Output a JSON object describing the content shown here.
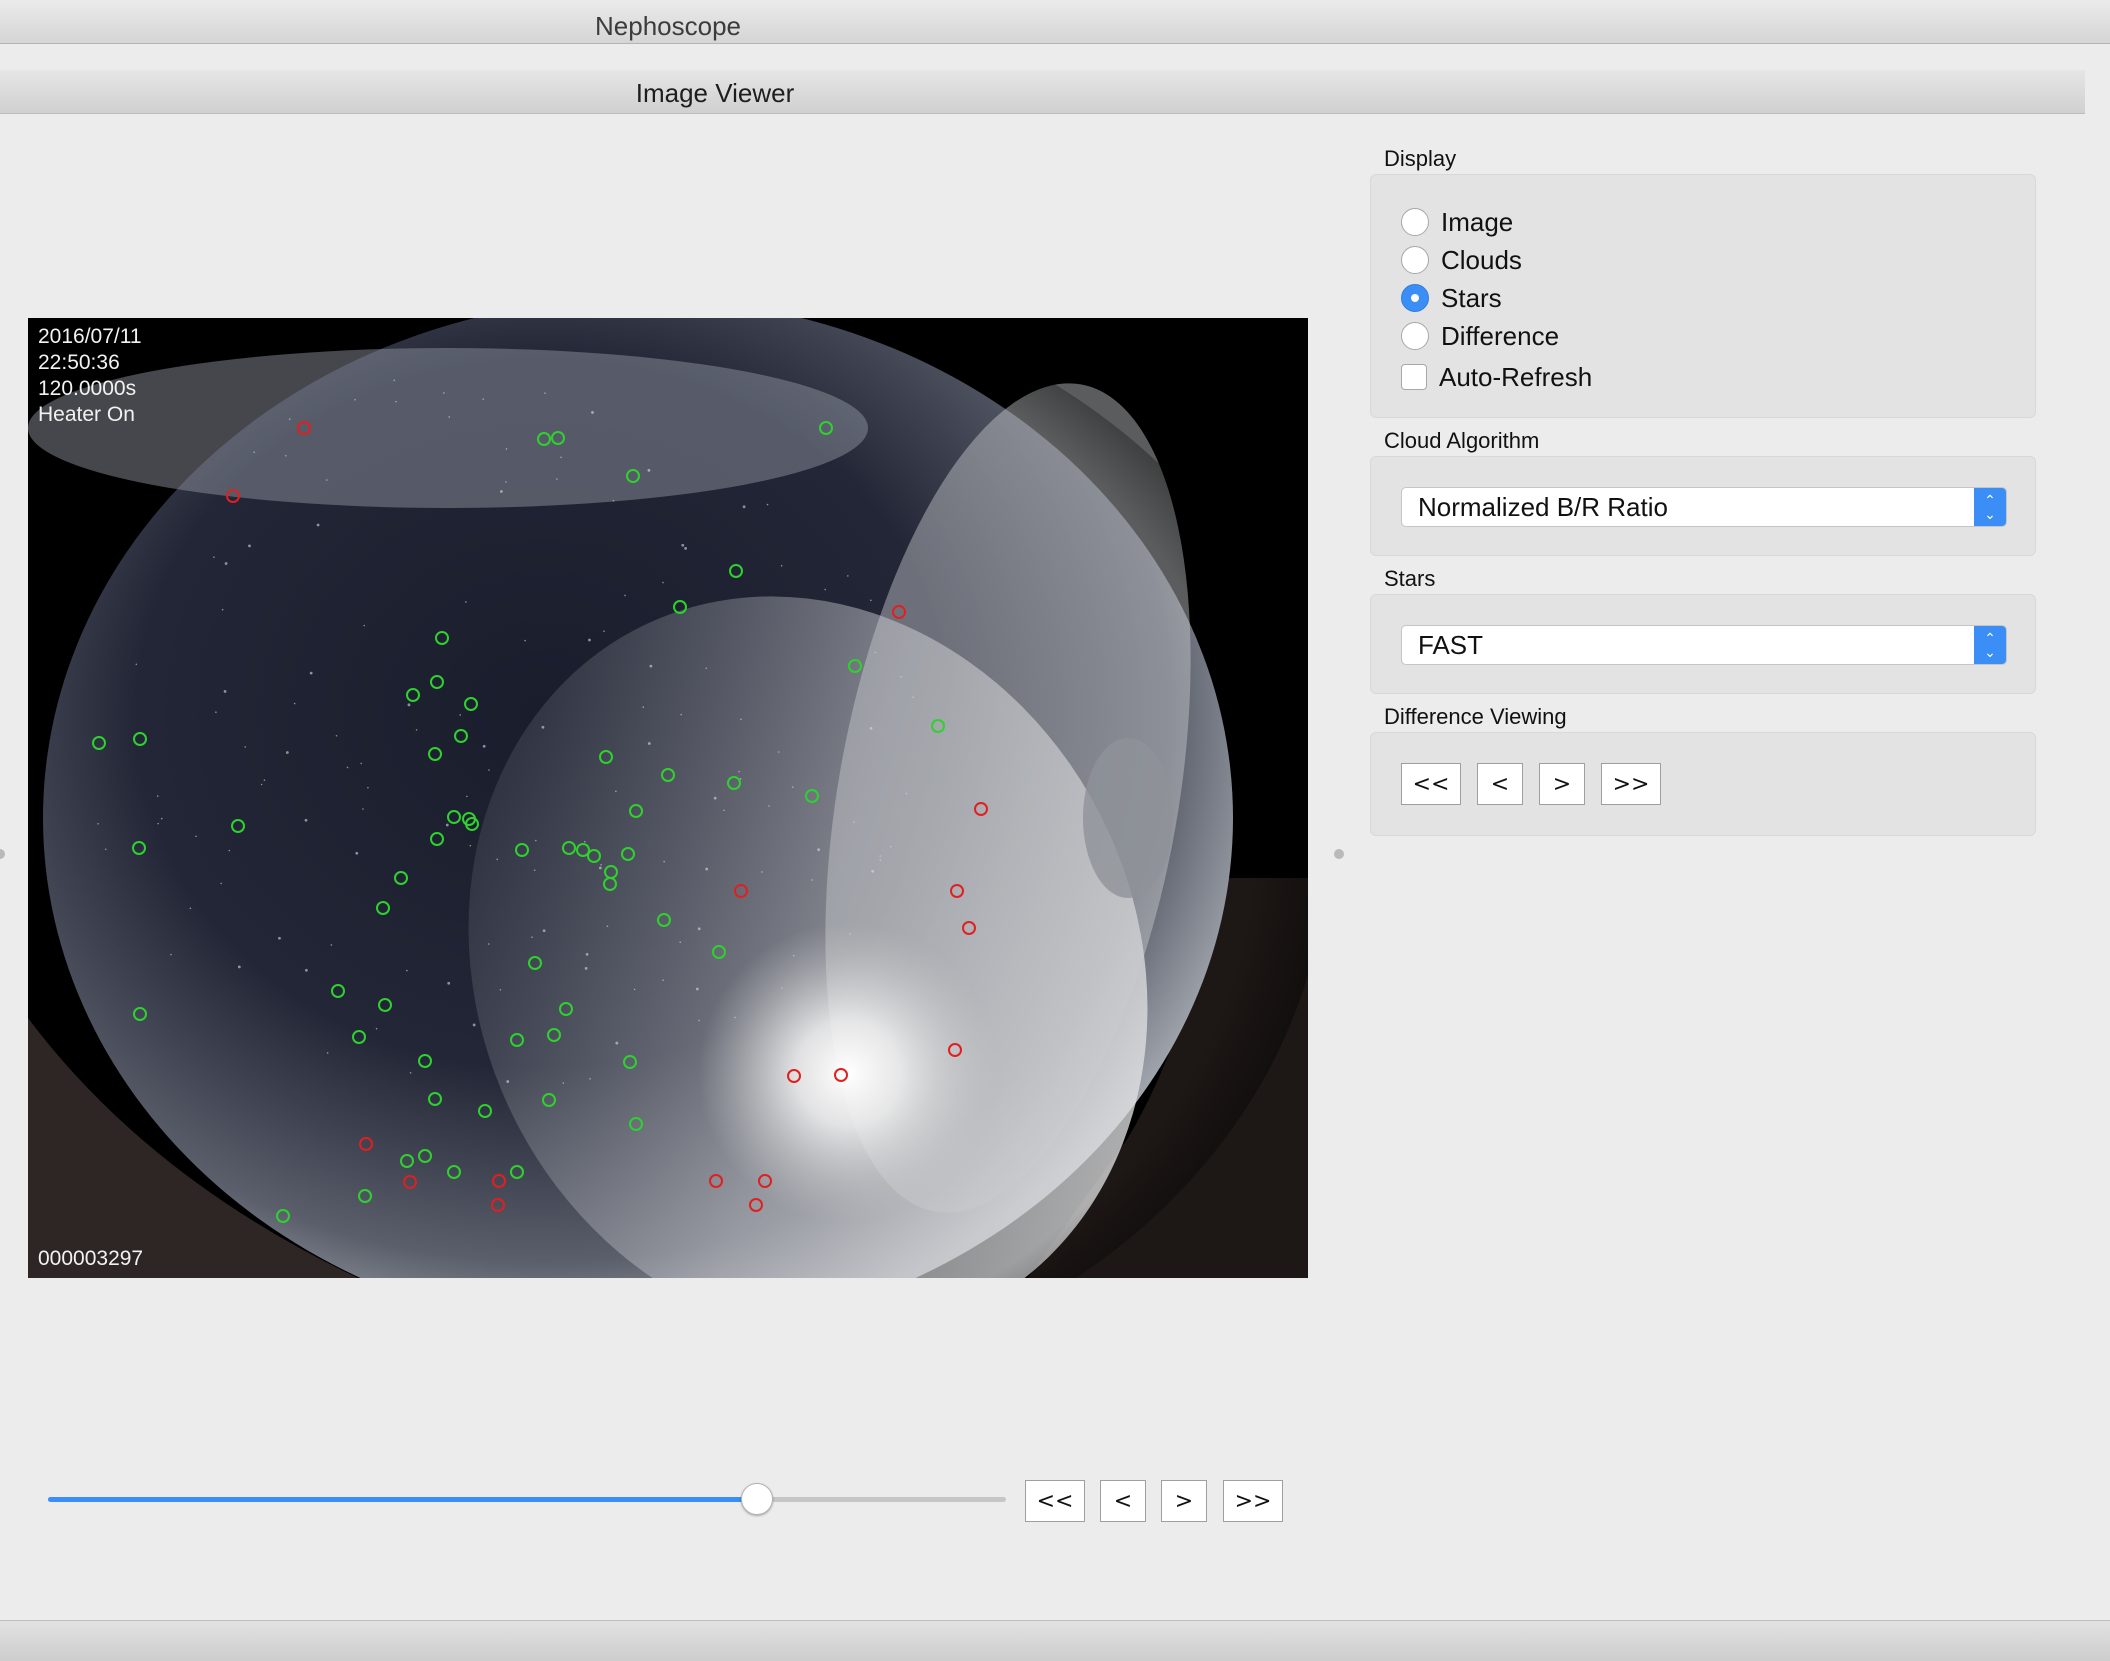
{
  "window": {
    "title": "Nephoscope"
  },
  "tab": {
    "title": "Image Viewer"
  },
  "viewer": {
    "overlay_lines": [
      "2016/07/11",
      "22:50:36",
      "120.0000s",
      "Heater On"
    ],
    "frame_number": "000003297"
  },
  "display": {
    "label": "Display",
    "options": [
      {
        "label": "Image",
        "checked": false
      },
      {
        "label": "Clouds",
        "checked": false
      },
      {
        "label": "Stars",
        "checked": true
      },
      {
        "label": "Difference",
        "checked": false
      }
    ],
    "auto_refresh_label": "Auto-Refresh",
    "auto_refresh_checked": false
  },
  "cloud_algorithm": {
    "label": "Cloud Algorithm",
    "value": "Normalized B/R Ratio"
  },
  "stars": {
    "label": "Stars",
    "value": "FAST"
  },
  "difference_viewing": {
    "label": "Difference Viewing",
    "buttons": [
      "<<",
      "<",
      ">",
      ">>"
    ]
  },
  "playback": {
    "slider_fraction": 0.74,
    "buttons": [
      "<<",
      "<",
      ">",
      ">>"
    ]
  },
  "colors": {
    "accent": "#3a8ef6",
    "matched_star_marker": "#2fd12f",
    "unmatched_star_marker": "#e02020"
  }
}
